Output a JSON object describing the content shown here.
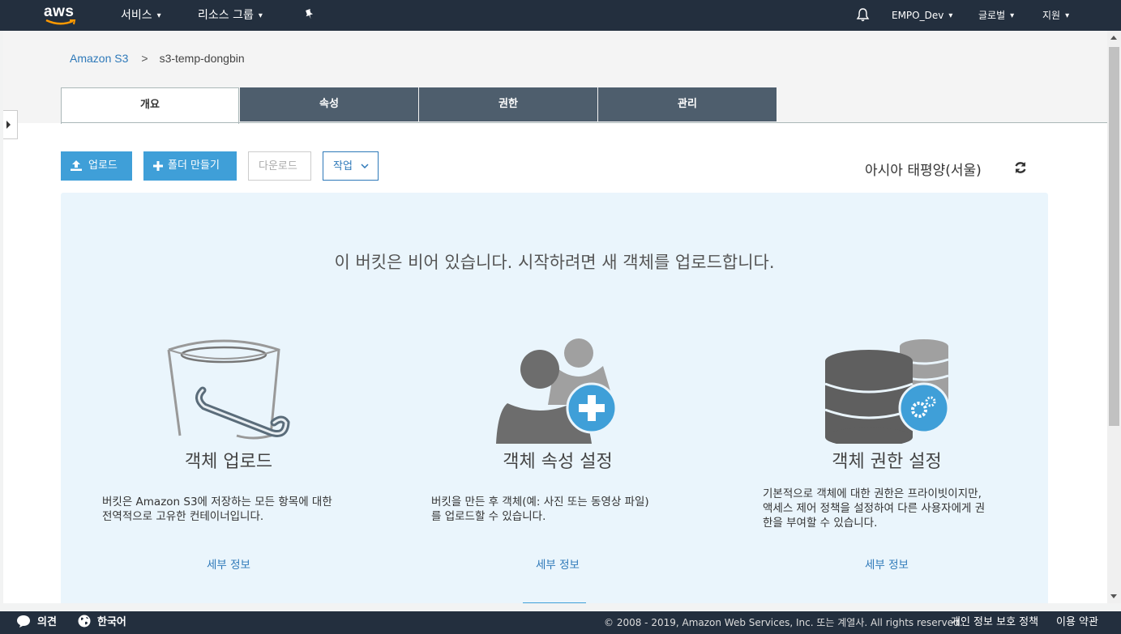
{
  "topnav": {
    "logo": "aws",
    "services": "서비스",
    "resource_groups": "리소스 그룹",
    "pin_icon": "pin-icon",
    "bell_icon": "bell-icon",
    "account": "EMPO_Dev",
    "region": "글로벌",
    "support": "지원"
  },
  "breadcrumb": {
    "root": "Amazon S3",
    "separator": ">",
    "current": "s3-temp-dongbin"
  },
  "tabs": [
    "개요",
    "속성",
    "권한",
    "관리"
  ],
  "active_tab": "개요",
  "toolbar": {
    "upload": "업로드",
    "create_folder": "폴더 만들기",
    "download": "다운로드",
    "actions": "작업",
    "region_label": "아시아 태평양(서울)"
  },
  "empty_state": {
    "message": "이 버킷은 비어 있습니다. 시작하려면 새 객체를 업로드합니다.",
    "cards": [
      {
        "icon": "bucket-icon",
        "title": "객체 업로드",
        "desc_lines": [
          "버킷은 Amazon S3에 저장하는 모든 항목에 대한",
          "전역적으로 고유한 컨테이너입니다."
        ],
        "link": "세부 정보"
      },
      {
        "icon": "users-add-icon",
        "title": "객체 속성 설정",
        "desc_lines": [
          "버킷을 만든 후 객체(예: 사진 또는 동영상 파일)",
          "를 업로드할 수 있습니다."
        ],
        "link": "세부 정보"
      },
      {
        "icon": "database-settings-icon",
        "title": "객체 권한 설정",
        "desc_lines": [
          "기본적으로 객체에 대한 권한은 프라이빗이지만,",
          "액세스 제어 정책을 설정하여 다른 사용자에게 권",
          "한을 부여할 수 있습니다."
        ],
        "link": "세부 정보"
      }
    ]
  },
  "footer": {
    "feedback": "의견",
    "language": "한국어",
    "copyright": "© 2008 - 2019, Amazon Web Services, Inc. 또는 계열사. All rights reserved.",
    "privacy": "개인 정보 보호 정책",
    "terms": "이용 약관"
  },
  "colors": {
    "nav_bg": "#232f3e",
    "primary": "#3f9fd8",
    "link": "#2e79b9",
    "panel_bg": "#eaf5fc",
    "tab_bg": "#4e5e6d"
  }
}
